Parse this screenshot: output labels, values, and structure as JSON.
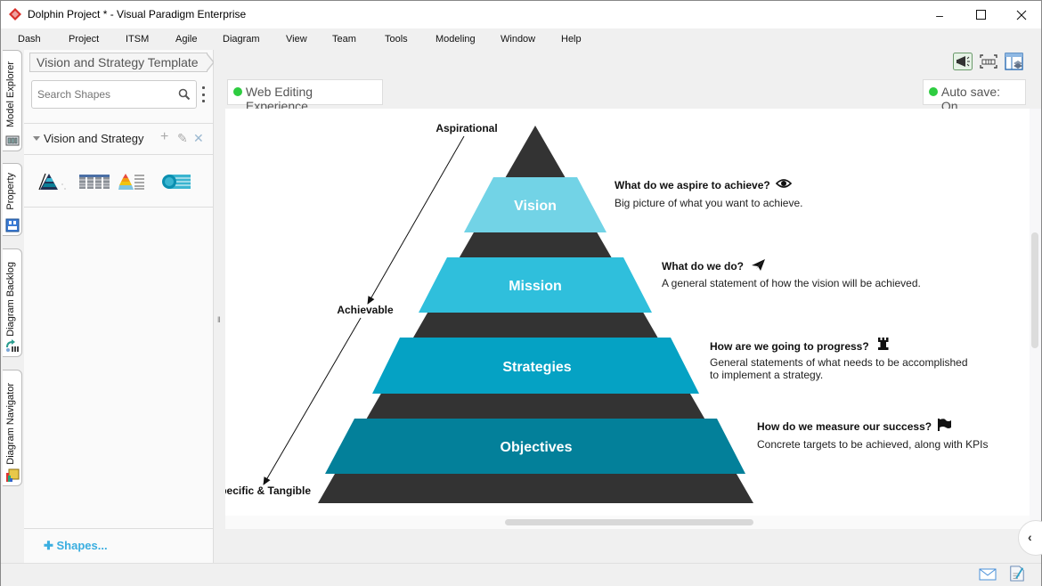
{
  "window": {
    "title": "Dolphin Project * - Visual Paradigm Enterprise",
    "controls": {
      "minimize": "–",
      "maximize": "☐",
      "close": "✕"
    }
  },
  "menu": [
    "Dash",
    "Project",
    "ITSM",
    "Agile",
    "Diagram",
    "View",
    "Team",
    "Tools",
    "Modeling",
    "Window",
    "Help"
  ],
  "left_tabs": [
    "Model Explorer",
    "Property",
    "Diagram Backlog",
    "Diagram Navigator"
  ],
  "breadcrumb": "Vision and Strategy Template",
  "shapes_panel": {
    "search_placeholder": "Search Shapes",
    "category": "Vision and Strategy",
    "category_actions": {
      "add": "+",
      "edit": "✎",
      "remove": "✕"
    },
    "add_shapes_label": "Shapes..."
  },
  "toolbar_icons": [
    "announcement-icon",
    "fit-to-window-icon",
    "layout-panel-icon"
  ],
  "badges": {
    "web_editing": "Web Editing Experience",
    "auto_save": "Auto save: On",
    "status_color": "#2ecc40"
  },
  "diagram": {
    "axis_labels": {
      "top": "Aspirational",
      "middle": "Achievable",
      "bottom": "Specific & Tangible"
    },
    "levels": [
      {
        "label": "Vision",
        "color": "#72d3e6",
        "question": "What do we aspire to achieve?",
        "icon": "eye-icon",
        "description": [
          "Big picture of what you want to achieve."
        ]
      },
      {
        "label": "Mission",
        "color": "#2fbfdc",
        "question": "What do we do?",
        "icon": "paper-plane-icon",
        "description": [
          "A general statement of how the vision will be achieved."
        ]
      },
      {
        "label": "Strategies",
        "color": "#05a2c4",
        "question": "How are we going to progress?",
        "icon": "chess-rook-icon",
        "description": [
          "General statements of what needs to be accomplished",
          "to implement a strategy."
        ]
      },
      {
        "label": "Objectives",
        "color": "#03809a",
        "question": "How do we measure our success?",
        "icon": "flag-icon",
        "description": [
          "Concrete targets to be achieved, along with KPIs"
        ]
      }
    ],
    "pyramid_color": "#333333"
  },
  "collapse_label": "‹"
}
